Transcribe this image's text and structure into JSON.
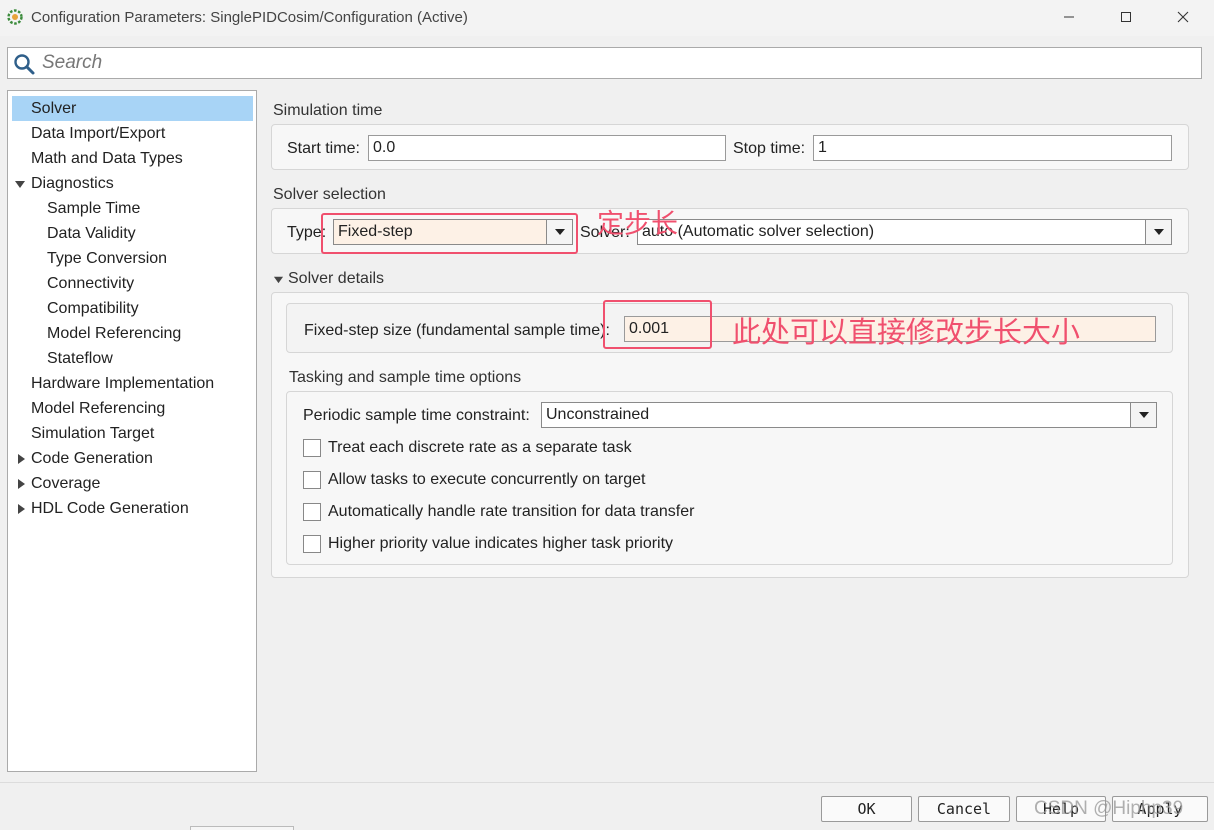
{
  "window": {
    "title": "Configuration Parameters: SinglePIDCosim/Configuration (Active)",
    "icon": "simulink-gear-icon"
  },
  "search": {
    "placeholder": "Search",
    "value": ""
  },
  "tree": {
    "items": [
      {
        "label": "Solver",
        "selected": true,
        "expandable": false
      },
      {
        "label": "Data Import/Export"
      },
      {
        "label": "Math and Data Types"
      },
      {
        "label": "Diagnostics",
        "expanded": true
      },
      {
        "label": "Sample Time"
      },
      {
        "label": "Data Validity"
      },
      {
        "label": "Type Conversion"
      },
      {
        "label": "Connectivity"
      },
      {
        "label": "Compatibility"
      },
      {
        "label": "Model Referencing"
      },
      {
        "label": "Stateflow"
      },
      {
        "label": "Hardware Implementation"
      },
      {
        "label": "Model Referencing"
      },
      {
        "label": "Simulation Target"
      },
      {
        "label": "Code Generation",
        "expanded": false
      },
      {
        "label": "Coverage",
        "expanded": false
      },
      {
        "label": "HDL Code Generation",
        "expanded": false
      }
    ]
  },
  "simulation_time": {
    "heading": "Simulation time",
    "start_label": "Start time:",
    "start_value": "0.0",
    "stop_label": "Stop time:",
    "stop_value": "1"
  },
  "solver_selection": {
    "heading": "Solver selection",
    "type_label": "Type:",
    "type_value": "Fixed-step",
    "solver_label": "Solver:",
    "solver_value": "auto (Automatic solver selection)"
  },
  "solver_details": {
    "heading": "Solver details",
    "step_label": "Fixed-step size (fundamental sample time):",
    "step_value": "0.001"
  },
  "tasking": {
    "heading": "Tasking and sample time options",
    "constraint_label": "Periodic sample time constraint:",
    "constraint_value": "Unconstrained",
    "checkboxes": [
      {
        "label": "Treat each discrete rate as a separate task",
        "checked": false
      },
      {
        "label": "Allow tasks to execute concurrently on target",
        "checked": false
      },
      {
        "label": "Automatically handle rate transition for data transfer",
        "checked": false
      },
      {
        "label": "Higher priority value indicates higher task priority",
        "checked": false
      }
    ]
  },
  "annotations": {
    "fixed_step_note": "定步长",
    "step_size_note": "此处可以直接修改步长大小",
    "color": "#f0506e"
  },
  "footer": {
    "ok": "OK",
    "cancel": "Cancel",
    "help": "Help",
    "apply": "Apply"
  },
  "watermark": "CSDN @Hiphp39",
  "colors": {
    "selection": "#a8d4f6",
    "edited_field": "#fdf1e6"
  }
}
